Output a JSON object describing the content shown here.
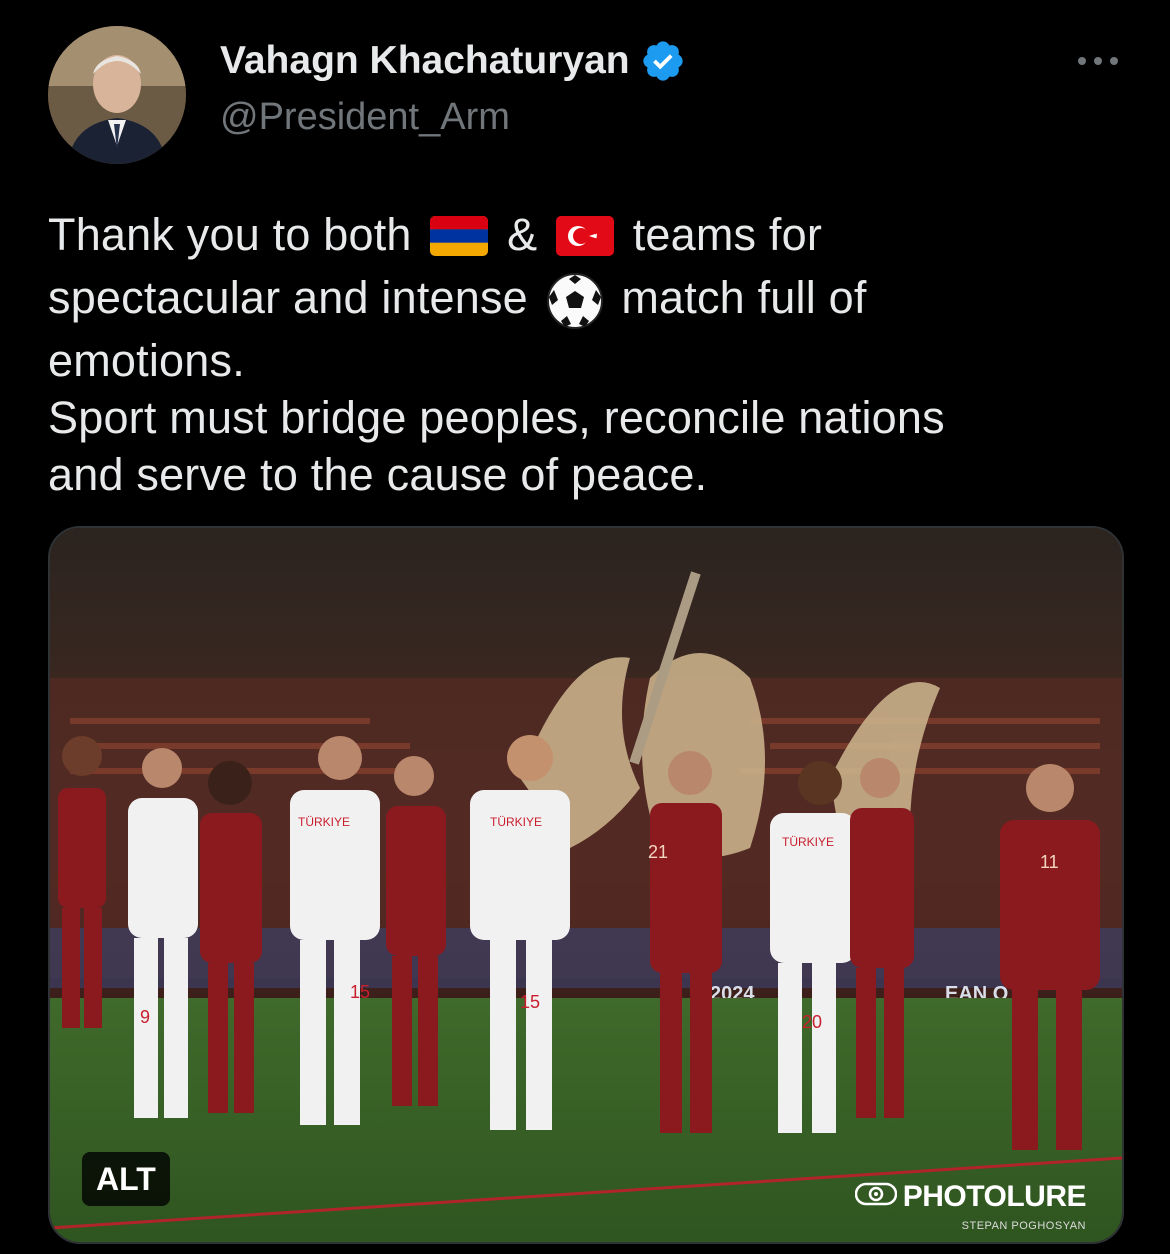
{
  "author": {
    "display_name": "Vahagn Khachaturyan",
    "handle": "@President_Arm",
    "verified": true,
    "verified_color": "#1d9bf0"
  },
  "tweet": {
    "line1_a": "Thank you to both",
    "line1_amp": "&",
    "line1_b": "teams for",
    "line2_a": "spectacular and intense",
    "line2_b": "match full of",
    "line3": "emotions.",
    "line4": "Sport must bridge peoples, reconcile nations",
    "line5": "and serve to the cause of peace.",
    "emoji": [
      "armenia-flag",
      "turkey-flag",
      "soccer-ball"
    ]
  },
  "media": {
    "alt_label": "ALT",
    "watermark_brand": "PHOTOLURE",
    "watermark_credit": "STEPAN POGHOSYAN",
    "board_text_1": "2024",
    "board_text_2": "EAN Q",
    "jersey_text": "TÜRKIYE",
    "jersey_numbers": [
      "9",
      "15",
      "21",
      "20",
      "11"
    ]
  },
  "colors": {
    "background": "#000000",
    "text": "#e7e9ea",
    "muted": "#71767b",
    "armenia_red": "#8b1a1f",
    "turkey_white": "#f1f1f1"
  }
}
